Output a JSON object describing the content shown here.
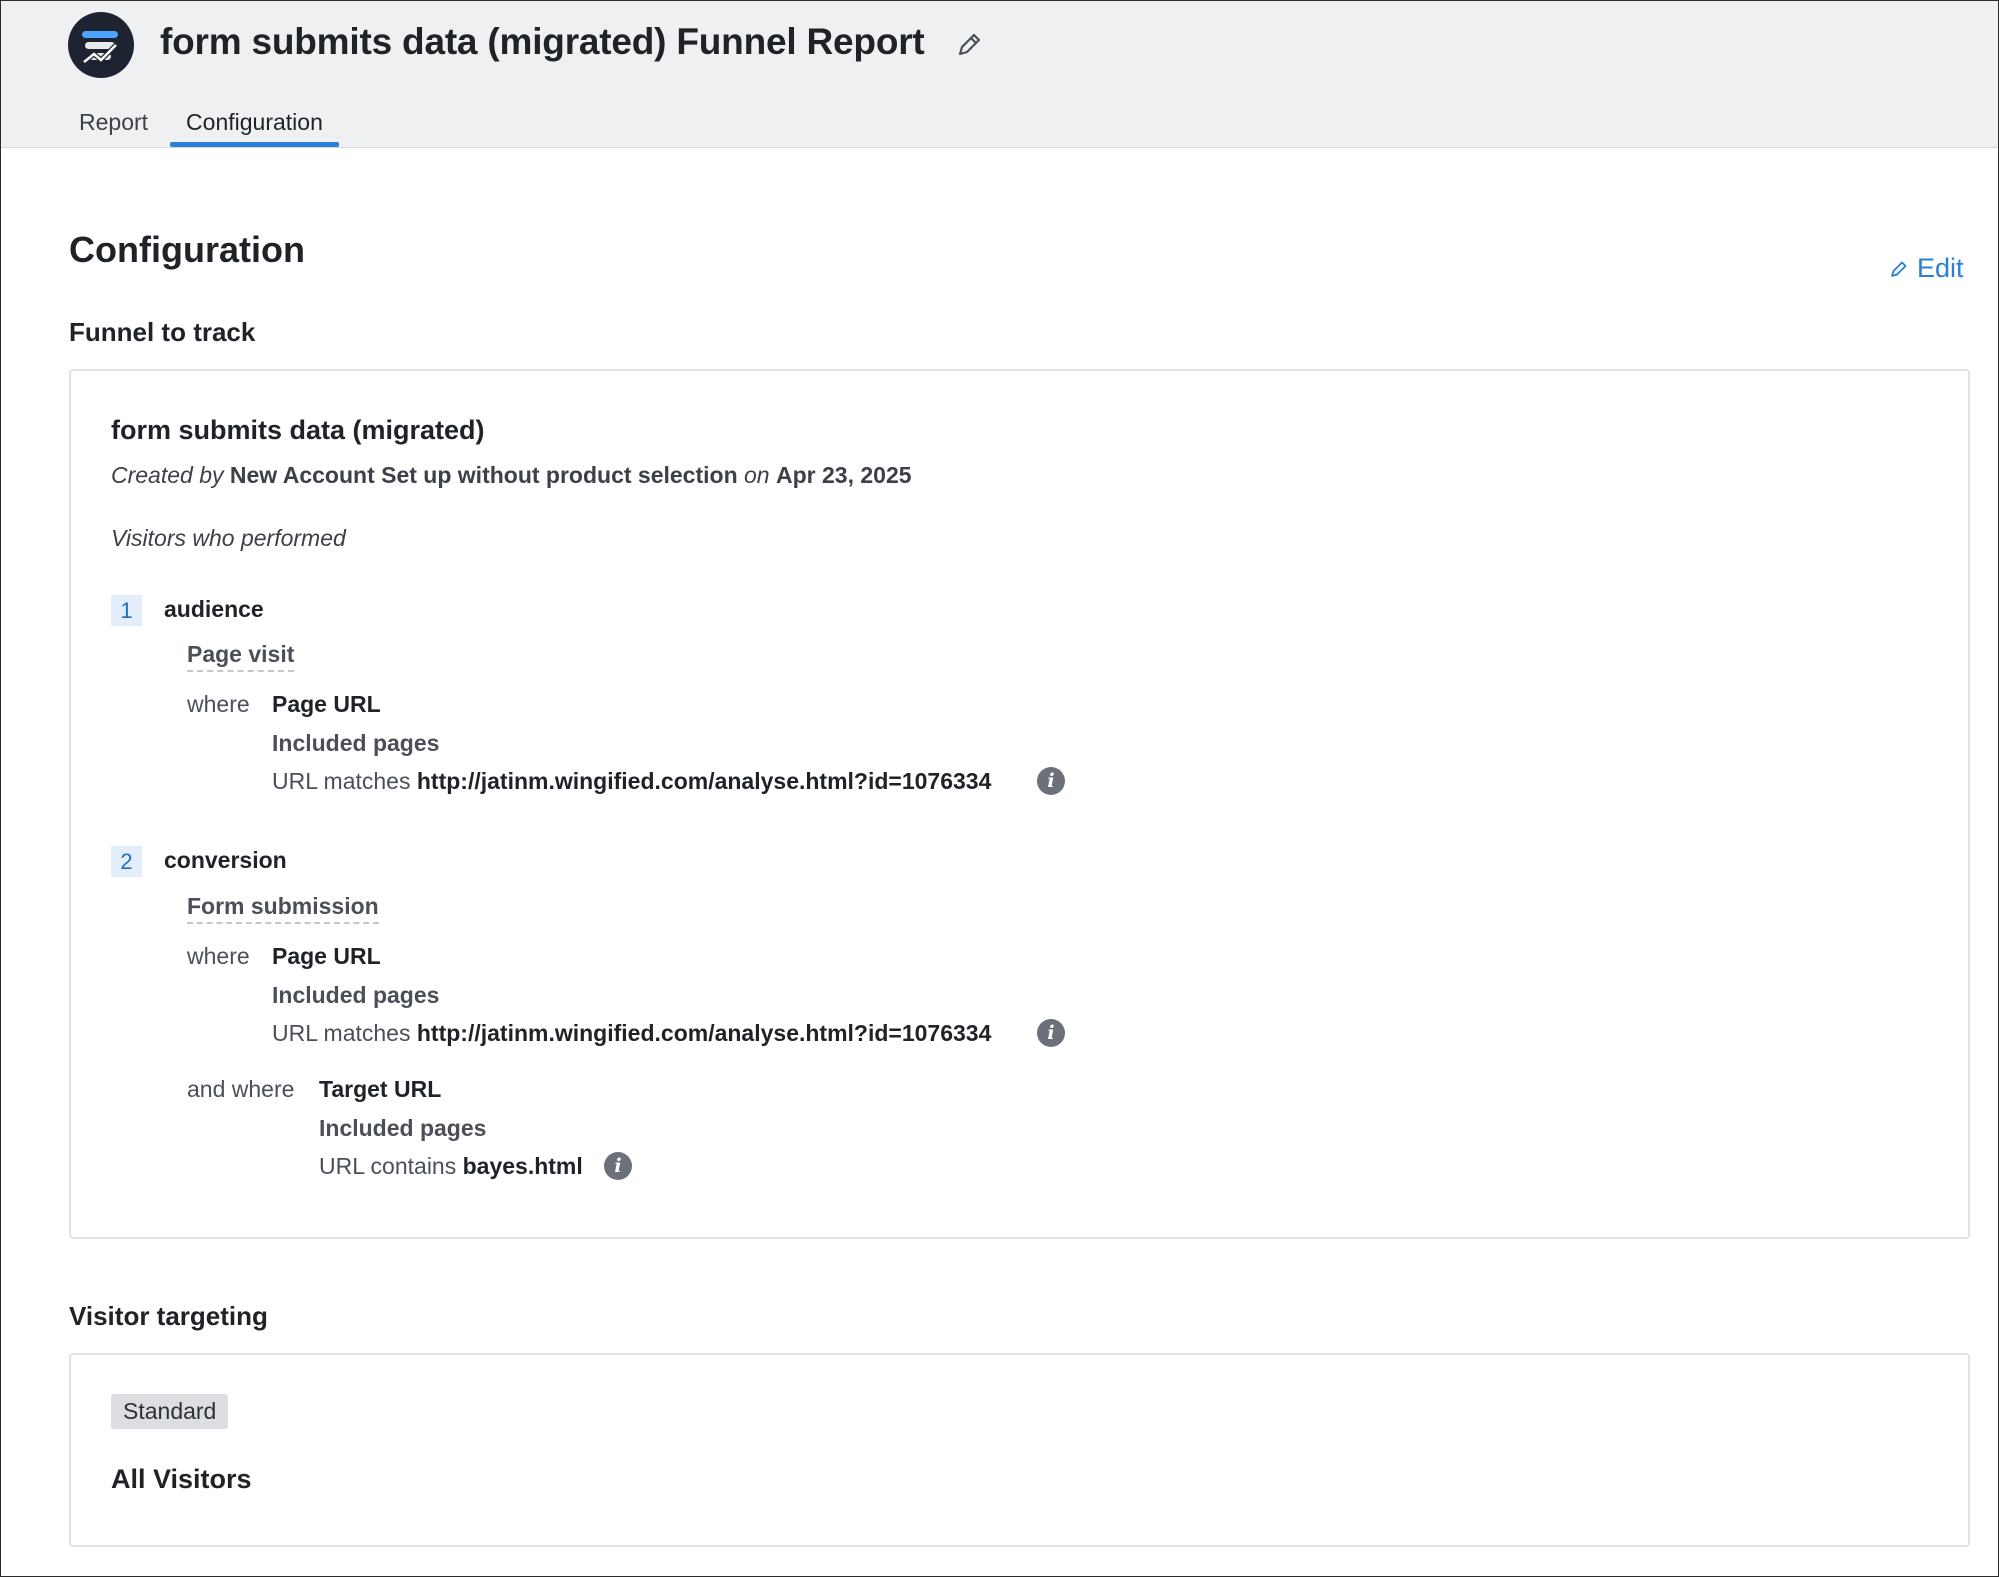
{
  "header": {
    "title": "form submits data (migrated) Funnel Report",
    "logo_icon": "app-logo",
    "edit_icon": "pencil-icon",
    "tabs": [
      {
        "label": "Report",
        "active": false
      },
      {
        "label": "Configuration",
        "active": true
      }
    ]
  },
  "main": {
    "heading": "Configuration",
    "edit_label": "Edit",
    "funnel_section_title": "Funnel to track",
    "funnel": {
      "name": "form submits data (migrated)",
      "created_by_prefix": "Created by",
      "creator": "New Account Set up without product selection",
      "on_word": "on",
      "date": "Apr 23, 2025",
      "visitors_label": "Visitors who performed",
      "steps": [
        {
          "number": "1",
          "name": "audience",
          "event": "Page visit",
          "conditions": [
            {
              "keyword": "where",
              "field": "Page URL",
              "subtitle": "Included pages",
              "match_label": "URL matches",
              "match_value": "http://jatinm.wingified.com/analyse.html?id=1076334"
            }
          ]
        },
        {
          "number": "2",
          "name": "conversion",
          "event": "Form submission",
          "conditions": [
            {
              "keyword": "where",
              "field": "Page URL",
              "subtitle": "Included pages",
              "match_label": "URL matches",
              "match_value": "http://jatinm.wingified.com/analyse.html?id=1076334"
            },
            {
              "keyword": "and where",
              "field": "Target URL",
              "subtitle": "Included pages",
              "match_label": "URL contains",
              "match_value": "bayes.html"
            }
          ]
        }
      ]
    },
    "targeting_section_title": "Visitor targeting",
    "targeting": {
      "badge": "Standard",
      "audience": "All Visitors"
    }
  },
  "colors": {
    "accent": "#2a7fd6",
    "header_bg": "#eff0f2",
    "step_badge_bg": "#e3eefa"
  }
}
